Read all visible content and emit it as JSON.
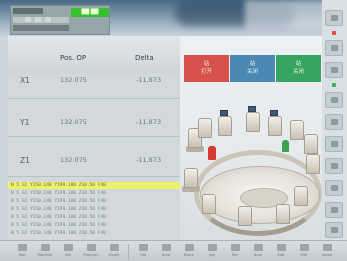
{
  "header": {
    "badge_label": "██ ██"
  },
  "table": {
    "columns": {
      "pos": "Pos. OP",
      "delta": "Delta"
    },
    "rows": [
      {
        "axis": "X1",
        "pos": "132.075",
        "delta": "-11,873"
      },
      {
        "axis": "Y1",
        "pos": "132.075",
        "delta": "-11,873"
      },
      {
        "axis": "Z1",
        "pos": "132.075",
        "delta": "-11,873"
      }
    ]
  },
  "history": [
    "N 5 G1 Y150.140 Y199.180 Z10.50 F40",
    "N 5 G1 Y150.140 Y199.180 Z10.50 F40",
    "N 5 G1 Y150.140 Y199.180 Z10.50 F40",
    "N 5 G1 Y150.140 Y199.180 Z10.50 F40",
    "N 5 G1 Y150.140 Y199.180 Z10.50 F40",
    "N 5 G1 Y150.140 Y199.180 Z10.50 F40",
    "N 5 G1 Y150.140 Y199.180 Z10.50 F40"
  ],
  "status_buttons": [
    {
      "line1": "站",
      "line2": "打开",
      "color": "#d5514a"
    },
    {
      "line1": "站",
      "line2": "关闭",
      "color": "#4b88b4"
    },
    {
      "line1": "站",
      "line2": "关闭",
      "color": "#38a461"
    }
  ],
  "toolbar": {
    "items": [
      {
        "label": "Tool",
        "icon": "tool-icon"
      },
      {
        "label": "Machine",
        "icon": "machine-icon"
      },
      {
        "label": "Set",
        "icon": "set-icon"
      },
      {
        "label": "Program",
        "icon": "program-icon"
      },
      {
        "label": "Single",
        "icon": "single-icon"
      },
      {
        "label": "Opt",
        "icon": "opt-icon"
      },
      {
        "label": "Stop",
        "icon": "stop-icon"
      },
      {
        "label": "Block",
        "icon": "block-icon"
      },
      {
        "label": "Jog",
        "icon": "jog-icon"
      },
      {
        "label": "Ref",
        "icon": "ref-icon"
      },
      {
        "label": "Auto",
        "icon": "auto-icon"
      },
      {
        "label": "Edit",
        "icon": "edit-icon"
      },
      {
        "label": "MDI",
        "icon": "mdi-icon"
      },
      {
        "label": "Home",
        "icon": "home-icon"
      }
    ]
  }
}
